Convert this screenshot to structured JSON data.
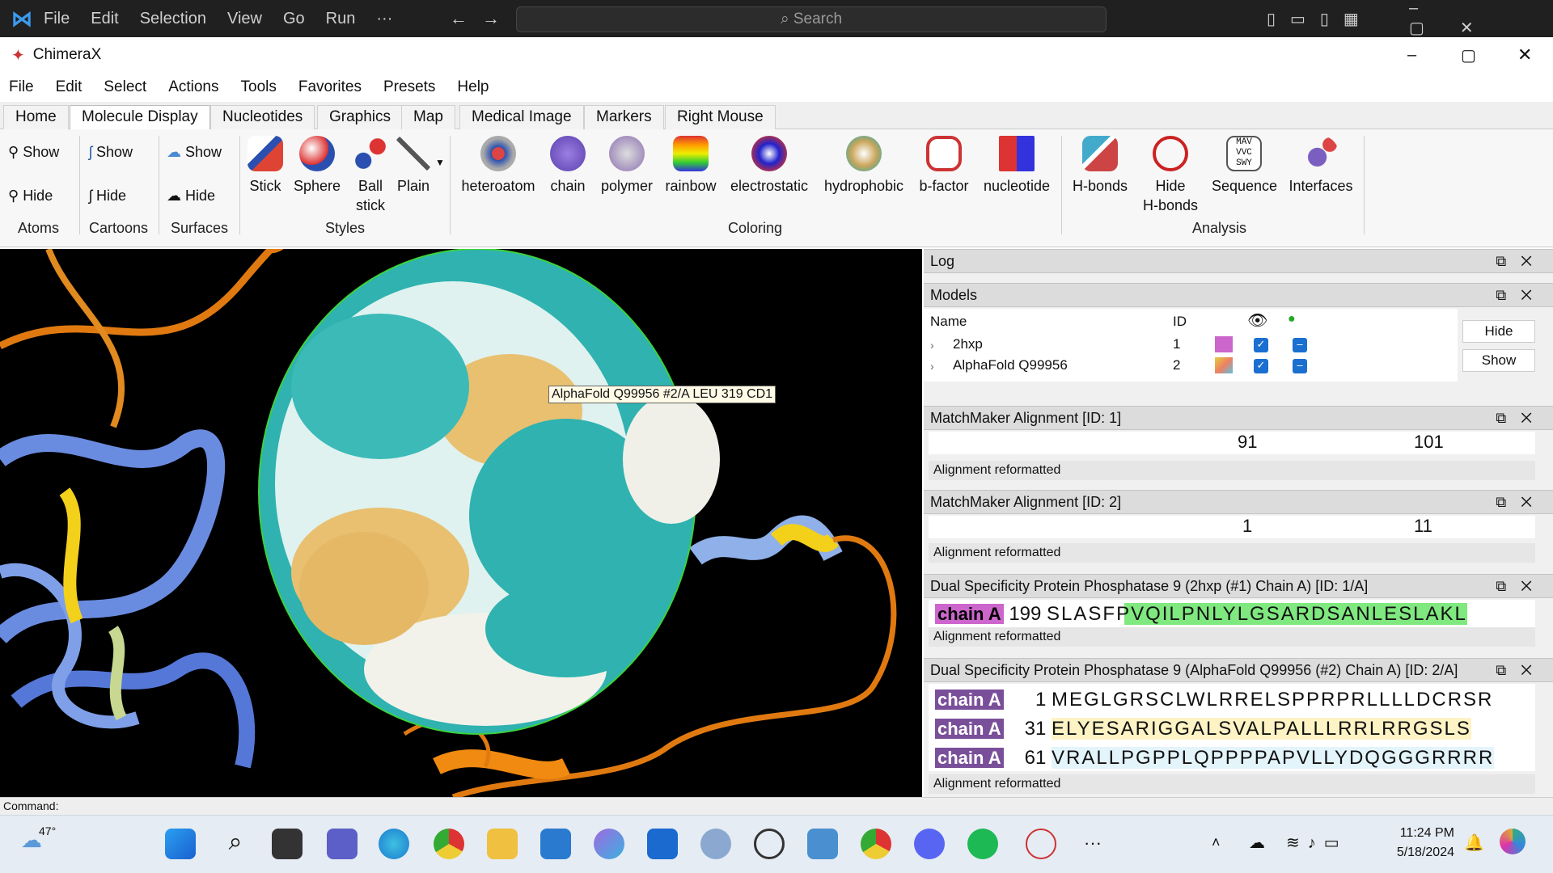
{
  "vscode": {
    "menus": [
      "File",
      "Edit",
      "Selection",
      "View",
      "Go",
      "Run",
      "···"
    ],
    "search_placeholder": "Search"
  },
  "window": {
    "title": "ChimeraX"
  },
  "menubar": [
    "File",
    "Edit",
    "Select",
    "Actions",
    "Tools",
    "Favorites",
    "Presets",
    "Help"
  ],
  "tabs": [
    "Home",
    "Molecule Display",
    "Nucleotides",
    "Graphics",
    "Map",
    "Medical Image",
    "Markers",
    "Right Mouse"
  ],
  "active_tab": "Molecule Display",
  "ribbon": {
    "atoms": {
      "show": "Show",
      "hide": "Hide",
      "label": "Atoms"
    },
    "cartoons": {
      "show": "Show",
      "hide": "Hide",
      "label": "Cartoons"
    },
    "surfaces": {
      "show": "Show",
      "hide": "Hide",
      "label": "Surfaces"
    },
    "styles": {
      "items": [
        "Stick",
        "Sphere",
        "Ball\nstick",
        "Plain"
      ],
      "label": "Styles"
    },
    "coloring": {
      "items": [
        "heteroatom",
        "chain",
        "polymer",
        "rainbow",
        "electrostatic",
        "hydrophobic",
        "b-factor",
        "nucleotide"
      ],
      "label": "Coloring"
    },
    "analysis": {
      "items": [
        "H-bonds",
        "Hide\nH-bonds",
        "Sequence",
        "Interfaces"
      ],
      "label": "Analysis"
    }
  },
  "tooltip": "AlphaFold Q99956 #2/A LEU 319 CD1",
  "log": {
    "title": "Log"
  },
  "models": {
    "title": "Models",
    "headers": {
      "name": "Name",
      "id": "ID"
    },
    "rows": [
      {
        "name": "2hxp",
        "id": "1",
        "color": "#cc66cc"
      },
      {
        "name": "AlphaFold Q99956",
        "id": "2",
        "color": "multi"
      }
    ],
    "hide": "Hide",
    "show": "Show"
  },
  "mm1": {
    "title": "MatchMaker Alignment [ID: 1]",
    "ticks": [
      "91",
      "101"
    ],
    "status": "Alignment reformatted"
  },
  "mm2": {
    "title": "MatchMaker Alignment [ID: 2]",
    "ticks": [
      "1",
      "11"
    ],
    "status": "Alignment reformatted"
  },
  "dsp1": {
    "title": "Dual Specificity Protein Phosphatase 9 (2hxp (#1) Chain A) [ID: 1/A]",
    "chain": "chain A",
    "num": "199",
    "seq": "SLASFPVQILPNLYLGSARDSANLESLAKL",
    "status": "Alignment reformatted"
  },
  "dsp2": {
    "title": "Dual Specificity Protein Phosphatase 9 (AlphaFold Q99956 (#2) Chain A) [ID: 2/A]",
    "rows": [
      {
        "chain": "chain A",
        "num": "1",
        "seq": "MEGLGRSCLWLRRELSPPRPRLLLLDCRSR"
      },
      {
        "chain": "chain A",
        "num": "31",
        "seq": "ELYESARIGGALSVALPALLLRRLRRGSLS"
      },
      {
        "chain": "chain A",
        "num": "61",
        "seq": "VRALLPGPPLQPPPPAPVLLYDQGGGRRRR"
      }
    ],
    "status": "Alignment reformatted"
  },
  "command": {
    "label": "Command:"
  },
  "taskbar": {
    "weather": "47°",
    "time": "11:24 PM",
    "date": "5/18/2024"
  }
}
